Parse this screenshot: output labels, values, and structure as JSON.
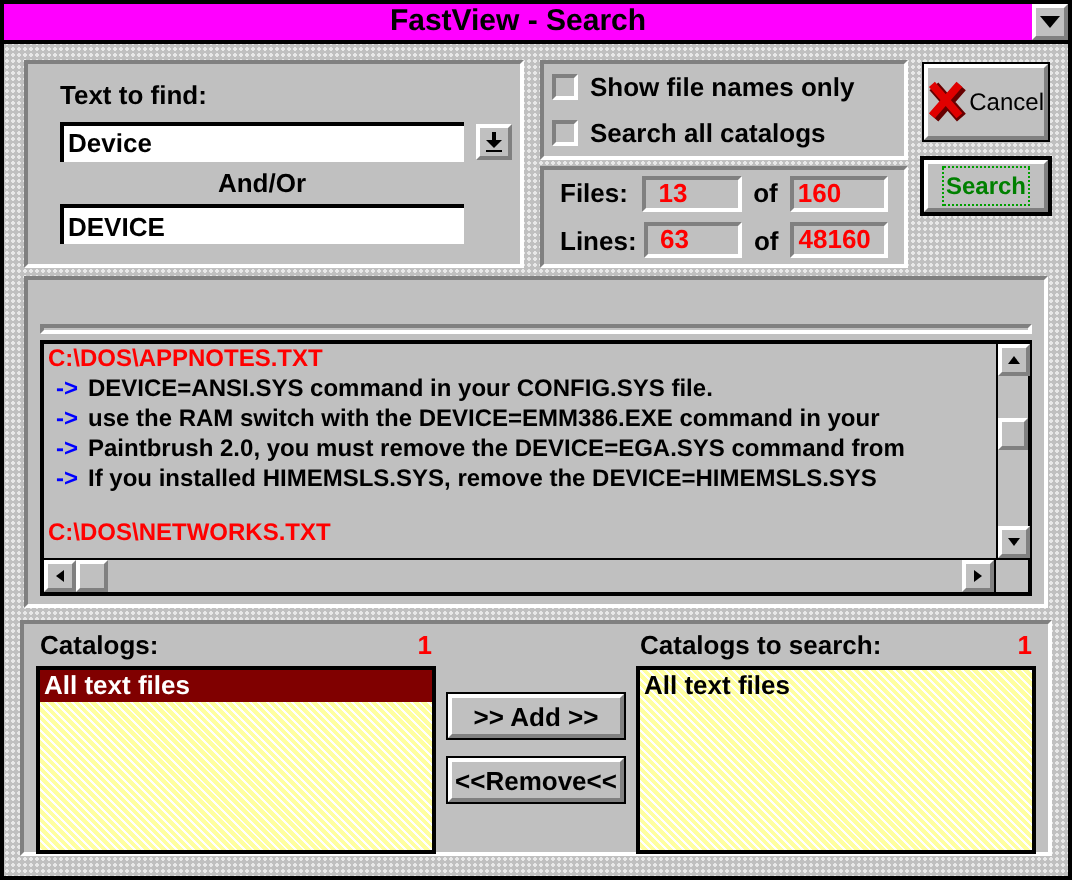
{
  "window": {
    "title": "FastView - Search"
  },
  "search": {
    "label": "Text to find:",
    "value": "Device",
    "connector": "And/Or",
    "second_value": "DEVICE"
  },
  "options": [
    {
      "label": "Show file names only",
      "checked": false
    },
    {
      "label": "Search all catalogs",
      "checked": false
    }
  ],
  "counts": [
    {
      "label": "Files:",
      "found": "13",
      "of": "of",
      "total": "160"
    },
    {
      "label": "Lines:",
      "found": "63",
      "of": "of",
      "total": "48160"
    }
  ],
  "buttons": {
    "cancel": "Cancel",
    "search": "Search"
  },
  "results": [
    {
      "file": "C:\\DOS\\APPNOTES.TXT",
      "lines": [
        {
          "marker": "->",
          "text": "DEVICE=ANSI.SYS command in your CONFIG.SYS file."
        },
        {
          "marker": "->",
          "text": "use the RAM switch with the DEVICE=EMM386.EXE command in your"
        },
        {
          "marker": "->",
          "text": "Paintbrush 2.0, you must remove the DEVICE=EGA.SYS command from"
        },
        {
          "marker": "->",
          "text": "If you installed HIMEMSLS.SYS, remove the DEVICE=HIMEMSLS.SYS"
        }
      ]
    },
    {
      "file": "C:\\DOS\\NETWORKS.TXT"
    }
  ],
  "catalogs": {
    "label": "Catalogs:",
    "count": "1",
    "items": [
      {
        "label": "All text files",
        "selected": true
      }
    ]
  },
  "transfer_buttons": [
    ">> Add >>",
    "<<Remove<<"
  ],
  "search_catalogs": {
    "label": "Catalogs to search:",
    "count": "1",
    "items": [
      {
        "label": "All text files",
        "selected": false
      }
    ]
  }
}
